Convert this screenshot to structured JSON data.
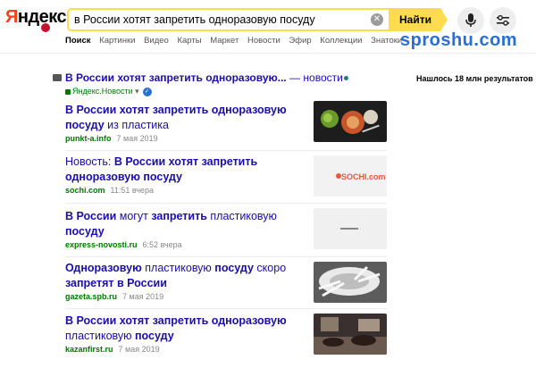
{
  "header": {
    "logo": "Яндекс",
    "search_value": "в России хотят запретить одноразовую посуду",
    "search_button": "Найти"
  },
  "tabs": [
    "Поиск",
    "Картинки",
    "Видео",
    "Карты",
    "Маркет",
    "Новости",
    "Эфир",
    "Коллекции",
    "Знатоки"
  ],
  "watermark": "sproshu.com",
  "results_count": "Нашлось 18 млн результатов",
  "news_block": {
    "title_bold": "В России хотят запретить одноразовую...",
    "title_rest": " — новости",
    "source": "Яндекс.Новости"
  },
  "results": [
    {
      "title_parts": [
        {
          "t": "В России хотят запретить одноразовую посуду",
          "b": true
        },
        {
          "t": " из пластика",
          "b": false
        }
      ],
      "source": "punkt-a.info",
      "time": "7 мая 2019",
      "thumb": "food-dark"
    },
    {
      "title_parts": [
        {
          "t": "Новость: ",
          "b": false
        },
        {
          "t": "В России хотят запретить одноразовую посуду",
          "b": true
        }
      ],
      "source": "sochi.com",
      "time": "11:51 вчера",
      "thumb": "sochi-logo"
    },
    {
      "title_parts": [
        {
          "t": "В России",
          "b": true
        },
        {
          "t": " могут ",
          "b": false
        },
        {
          "t": "запретить",
          "b": true
        },
        {
          "t": " пластиковую ",
          "b": false
        },
        {
          "t": "посуду",
          "b": true
        }
      ],
      "source": "express-novosti.ru",
      "time": "6:52 вчера",
      "thumb": "blank"
    },
    {
      "title_parts": [
        {
          "t": "Одноразовую",
          "b": true
        },
        {
          "t": " пластиковую ",
          "b": false
        },
        {
          "t": "посуду",
          "b": true
        },
        {
          "t": " скоро ",
          "b": false
        },
        {
          "t": "запретят в России",
          "b": true
        }
      ],
      "source": "gazeta.spb.ru",
      "time": "7 мая 2019",
      "thumb": "cups"
    },
    {
      "title_parts": [
        {
          "t": "В России хотят запретить одноразовую",
          "b": true
        },
        {
          "t": " пластиковую ",
          "b": false
        },
        {
          "t": "посуду",
          "b": true
        }
      ],
      "source": "kazanfirst.ru",
      "time": "7 мая 2019",
      "thumb": "cafe"
    }
  ],
  "thumb_text": {
    "sochi": "SOCHI.com"
  }
}
